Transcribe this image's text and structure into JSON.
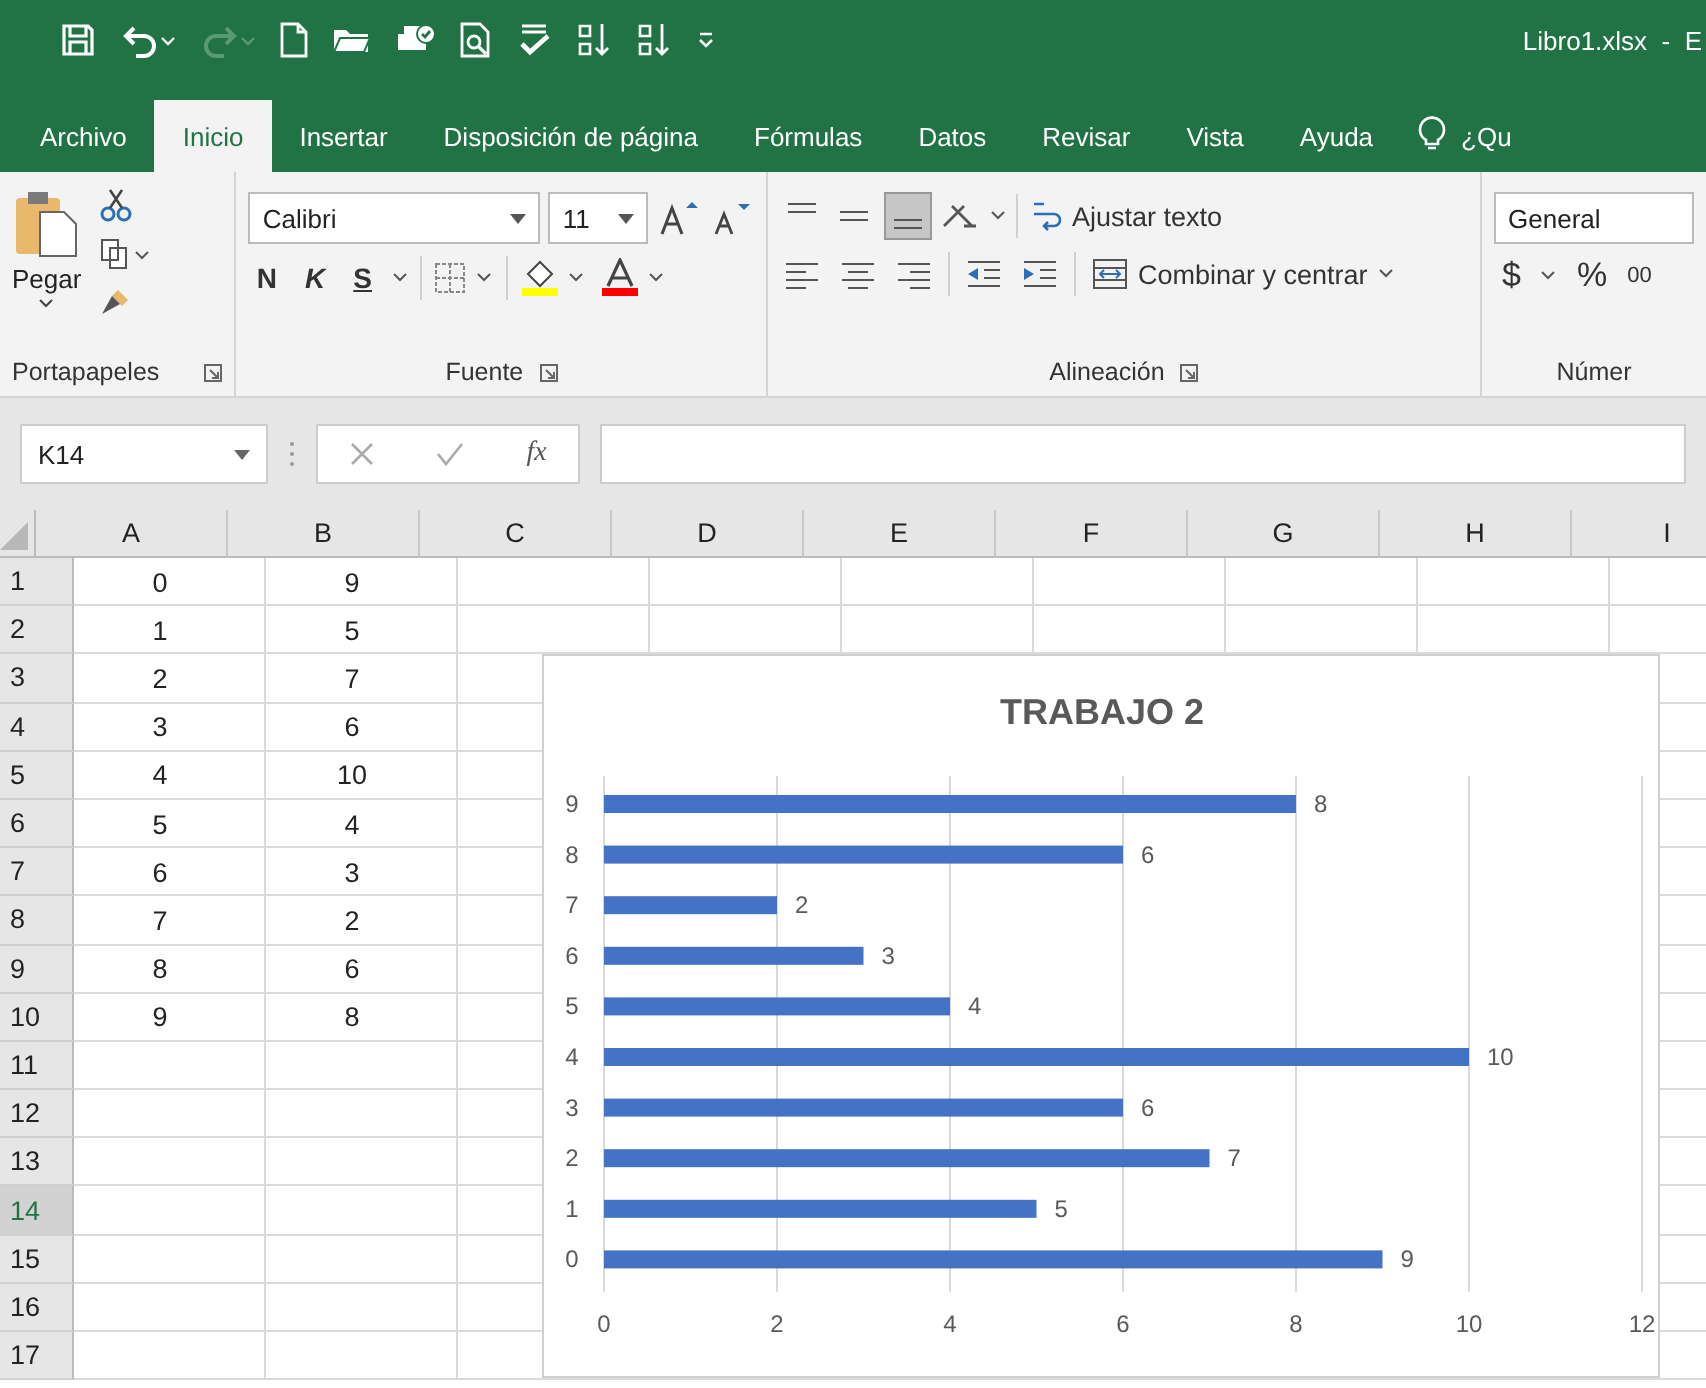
{
  "window": {
    "title": "Libro1.xlsx  -  E"
  },
  "tabs": [
    {
      "label": "Archivo",
      "selected": false
    },
    {
      "label": "Inicio",
      "selected": true
    },
    {
      "label": "Insertar",
      "selected": false
    },
    {
      "label": "Disposición de página",
      "selected": false
    },
    {
      "label": "Fórmulas",
      "selected": false
    },
    {
      "label": "Datos",
      "selected": false
    },
    {
      "label": "Revisar",
      "selected": false
    },
    {
      "label": "Vista",
      "selected": false
    },
    {
      "label": "Ayuda",
      "selected": false
    }
  ],
  "tell_me": "¿Qu",
  "ribbon": {
    "clipboard": {
      "paste": "Pegar",
      "group": "Portapapeles"
    },
    "font": {
      "name": "Calibri",
      "size": "11",
      "bold": "N",
      "italic": "K",
      "underline": "S",
      "group": "Fuente"
    },
    "alignment": {
      "wrap": "Ajustar texto",
      "merge": "Combinar y centrar",
      "group": "Alineación"
    },
    "number": {
      "format": "General",
      "currency": "$",
      "percent": "%",
      "thousands": "00",
      "group": "Númer"
    }
  },
  "formula_bar": {
    "name_box": "K14",
    "function": "fx"
  },
  "grid": {
    "columns": [
      "A",
      "B",
      "C",
      "D",
      "E",
      "F",
      "G",
      "H",
      "I"
    ],
    "rows": [
      {
        "header": "1",
        "selected": false,
        "cells": [
          "0",
          "9"
        ]
      },
      {
        "header": "2",
        "selected": false,
        "cells": [
          "1",
          "5"
        ]
      },
      {
        "header": "3",
        "selected": false,
        "cells": [
          "2",
          "7"
        ]
      },
      {
        "header": "4",
        "selected": false,
        "cells": [
          "3",
          "6"
        ]
      },
      {
        "header": "5",
        "selected": false,
        "cells": [
          "4",
          "10"
        ]
      },
      {
        "header": "6",
        "selected": false,
        "cells": [
          "5",
          "4"
        ]
      },
      {
        "header": "7",
        "selected": false,
        "cells": [
          "6",
          "3"
        ]
      },
      {
        "header": "8",
        "selected": false,
        "cells": [
          "7",
          "2"
        ]
      },
      {
        "header": "9",
        "selected": false,
        "cells": [
          "8",
          "6"
        ]
      },
      {
        "header": "10",
        "selected": false,
        "cells": [
          "9",
          "8"
        ]
      },
      {
        "header": "11",
        "selected": false,
        "cells": []
      },
      {
        "header": "12",
        "selected": false,
        "cells": []
      },
      {
        "header": "13",
        "selected": false,
        "cells": []
      },
      {
        "header": "14",
        "selected": true,
        "cells": []
      },
      {
        "header": "15",
        "selected": false,
        "cells": []
      },
      {
        "header": "16",
        "selected": false,
        "cells": []
      },
      {
        "header": "17",
        "selected": false,
        "cells": []
      }
    ]
  },
  "chart": {
    "chart_data": {
      "type": "bar",
      "orientation": "horizontal",
      "title": "TRABAJO 2",
      "categories": [
        "9",
        "8",
        "7",
        "6",
        "5",
        "4",
        "3",
        "2",
        "1",
        "0"
      ],
      "series": [
        {
          "color": "#4472c4",
          "values": [
            8,
            6,
            2,
            3,
            4,
            10,
            6,
            7,
            5,
            9
          ]
        }
      ],
      "xlim": [
        0,
        12
      ],
      "xticks": [
        0,
        2,
        4,
        6,
        8,
        10,
        12
      ],
      "grid": true,
      "data_labels": true
    }
  }
}
